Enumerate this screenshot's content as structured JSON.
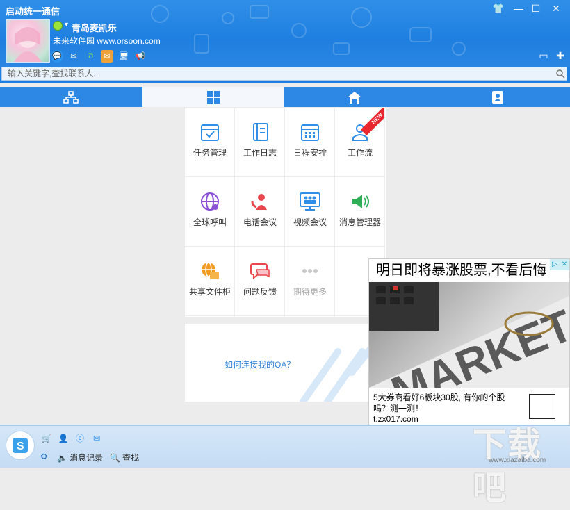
{
  "window": {
    "title": "启动统一通信",
    "controls": [
      "shirt-icon",
      "minimize-icon",
      "maximize-icon",
      "close-icon"
    ]
  },
  "profile": {
    "name": "青岛麦凯乐",
    "signature": "未来软件园 www.orsoon.com"
  },
  "search": {
    "placeholder": "输入关键字,查找联系人..."
  },
  "tabs": [
    {
      "id": "org",
      "icon": "org-chart-icon"
    },
    {
      "id": "apps",
      "icon": "app-grid-icon",
      "active": true
    },
    {
      "id": "home",
      "icon": "home-icon"
    },
    {
      "id": "contacts",
      "icon": "contact-card-icon"
    }
  ],
  "apps": [
    {
      "label": "任务管理",
      "icon": "task-calendar-icon",
      "color": "#2f8fe8"
    },
    {
      "label": "工作日志",
      "icon": "journal-icon",
      "color": "#2f8fe8"
    },
    {
      "label": "日程安排",
      "icon": "schedule-calendar-icon",
      "color": "#2f8fe8"
    },
    {
      "label": "工作流",
      "icon": "workflow-person-icon",
      "color": "#2f8fe8",
      "badge": "NEW"
    },
    {
      "label": "全球呼叫",
      "icon": "globe-call-icon",
      "color": "#8b4fd6"
    },
    {
      "label": "电话会议",
      "icon": "phone-conference-icon",
      "color": "#e8474e"
    },
    {
      "label": "视频会议",
      "icon": "video-conference-icon",
      "color": "#2f8fe8"
    },
    {
      "label": "消息管理器",
      "icon": "speaker-icon",
      "color": "#2fae57"
    },
    {
      "label": "共享文件柜",
      "icon": "shared-folder-icon",
      "color": "#f29a1e"
    },
    {
      "label": "问题反馈",
      "icon": "feedback-bubble-icon",
      "color": "#e8474e"
    },
    {
      "label": "期待更多",
      "icon": "more-dots-icon",
      "color": "#bbbbbb",
      "disabled": true
    }
  ],
  "link": {
    "text": "如何连接我的OA？"
  },
  "ad": {
    "headline": "明日即将暴涨股票,不看后悔",
    "image_text": "MARKETS",
    "description": "5大券商看好6板块30股, 有你的个股吗？测一测！",
    "domain": "t.zx017.com"
  },
  "footer": {
    "links": [
      {
        "label": "消息记录",
        "icon": "speaker-icon"
      },
      {
        "label": "查找",
        "icon": "search-icon"
      }
    ]
  },
  "watermark": {
    "logo": "下载吧",
    "url": "www.xiazaiba.com"
  }
}
